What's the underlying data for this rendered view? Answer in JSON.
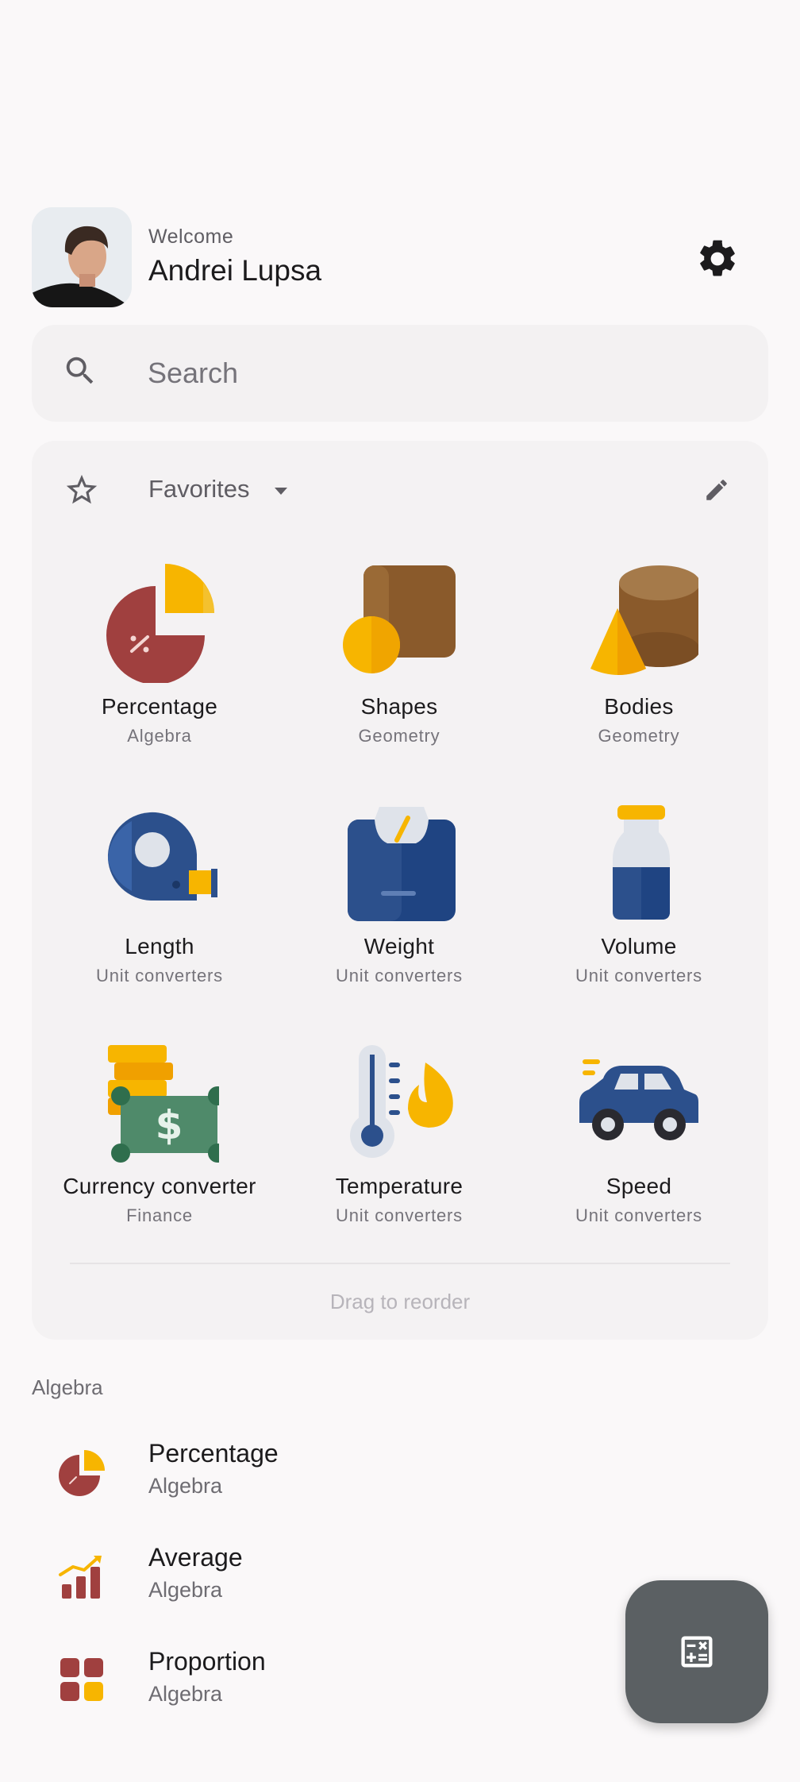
{
  "header": {
    "welcome_label": "Welcome",
    "user_name": "Andrei Lupsa"
  },
  "search": {
    "placeholder": "Search"
  },
  "favorites": {
    "title": "Favorites",
    "drag_hint": "Drag to reorder",
    "items": [
      {
        "name": "Percentage",
        "category": "Algebra",
        "icon": "percentage-pie-icon"
      },
      {
        "name": "Shapes",
        "category": "Geometry",
        "icon": "shapes-icon"
      },
      {
        "name": "Bodies",
        "category": "Geometry",
        "icon": "bodies-icon"
      },
      {
        "name": "Length",
        "category": "Unit converters",
        "icon": "tape-measure-icon"
      },
      {
        "name": "Weight",
        "category": "Unit converters",
        "icon": "weight-box-icon"
      },
      {
        "name": "Volume",
        "category": "Unit converters",
        "icon": "bottle-icon"
      },
      {
        "name": "Currency converter",
        "category": "Finance",
        "icon": "money-icon"
      },
      {
        "name": "Temperature",
        "category": "Unit converters",
        "icon": "thermometer-icon"
      },
      {
        "name": "Speed",
        "category": "Unit converters",
        "icon": "car-icon"
      }
    ]
  },
  "algebra": {
    "section_label": "Algebra",
    "items": [
      {
        "title": "Percentage",
        "subtitle": "Algebra",
        "icon": "percentage-pie-icon"
      },
      {
        "title": "Average",
        "subtitle": "Algebra",
        "icon": "average-chart-icon"
      },
      {
        "title": "Proportion",
        "subtitle": "Algebra",
        "icon": "proportion-grid-icon"
      }
    ]
  },
  "colors": {
    "background": "#faf8f9",
    "card": "#f4f2f3",
    "fab": "#5b6063",
    "red": "#a0403f",
    "yellow": "#f7b500",
    "blue": "#2c508c",
    "brown": "#8a5a2b",
    "green": "#4f8a6a"
  }
}
